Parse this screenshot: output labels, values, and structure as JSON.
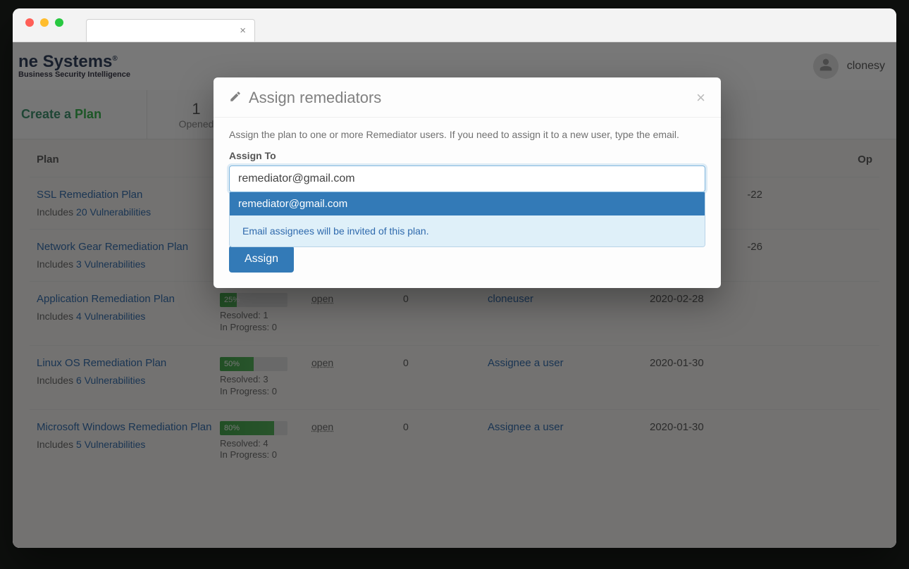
{
  "header": {
    "logo_main": "ne Systems",
    "logo_reg": "®",
    "logo_sub": "Business Security Intelligence",
    "username": "clonesy"
  },
  "stats": {
    "create_plan_1": "Create a ",
    "create_plan_2": "Plan",
    "opened_count": "1",
    "opened_label": "Opened"
  },
  "table": {
    "headers": {
      "plan": "Plan",
      "open": "Op"
    },
    "rows": [
      {
        "name": "SSL Remediation Plan",
        "inc_prefix": "Includes ",
        "inc_link": "20 Vulnerabilities",
        "date": "-22",
        "date_full": "2020-02-22"
      },
      {
        "name": "Network Gear Remediation Plan",
        "inc_prefix": "Includes ",
        "inc_link": "3 Vulnerabilities",
        "date": "-26",
        "date_full": "2020-02-26"
      },
      {
        "name": "Application Remediation Plan",
        "inc_prefix": "Includes ",
        "inc_link": "4 Vulnerabilities",
        "progress_pct": "25%",
        "progress_w": 25,
        "resolved": "Resolved: 1",
        "inprog": "In Progress: 0",
        "status": "open",
        "comments": "0",
        "assignee": "cloneuser",
        "date": "2020-02-28"
      },
      {
        "name": "Linux OS Remediation Plan",
        "inc_prefix": "Includes ",
        "inc_link": "6 Vulnerabilities",
        "progress_pct": "50%",
        "progress_w": 50,
        "resolved": "Resolved: 3",
        "inprog": "In Progress: 0",
        "status": "open",
        "comments": "0",
        "assignee": "Assignee a user",
        "date": "2020-01-30"
      },
      {
        "name": "Microsoft Windows Remediation Plan",
        "inc_prefix": "Includes ",
        "inc_link": "5 Vulnerabilities",
        "progress_pct": "80%",
        "progress_w": 80,
        "resolved": "Resolved: 4",
        "inprog": "In Progress: 0",
        "status": "open",
        "comments": "0",
        "assignee": "Assignee a user",
        "date": "2020-01-30"
      }
    ]
  },
  "modal": {
    "title": "Assign remediators",
    "desc": "Assign the plan to one or more Remediator users. If you need to assign it to a new user, type the email.",
    "label": "Assign To",
    "input_value": "remediator@gmail.com",
    "suggestion": "remediator@gmail.com",
    "hint": "Email assignees will be invited of this plan.",
    "button": "Assign",
    "close": "×"
  },
  "tab": {
    "close": "×"
  }
}
